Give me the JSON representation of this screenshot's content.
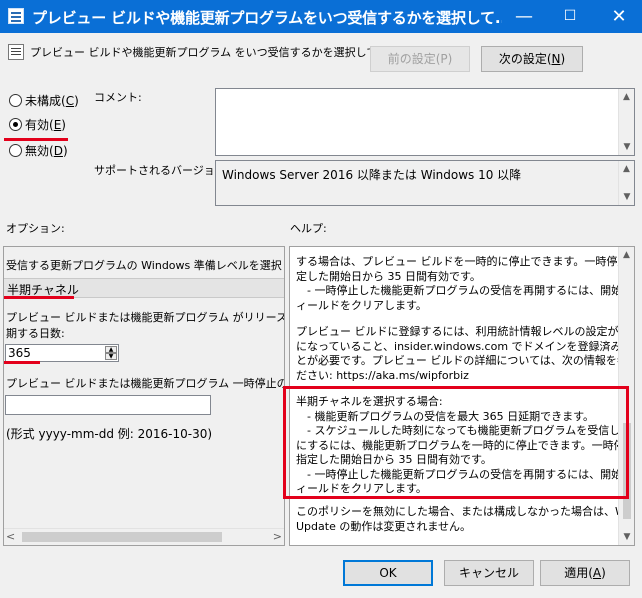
{
  "window": {
    "title": "プレビュー ビルドや機能更新プログラムをいつ受信するかを選択して...",
    "minimize_glyph": "—",
    "maximize_glyph": "☐",
    "close_glyph": "✕"
  },
  "header": {
    "text": "プレビュー ビルドや機能更新プログラム をいつ受信するかを選択してください",
    "prev_button": "前の設定(P)",
    "next_button_prefix": "次の設定(",
    "next_button_key": "N",
    "next_button_suffix": ")"
  },
  "radios": [
    {
      "prefix": "未構成(",
      "key": "C",
      "suffix": ")",
      "selected": false
    },
    {
      "prefix": "有効(",
      "key": "E",
      "suffix": ")",
      "selected": true
    },
    {
      "prefix": "無効(",
      "key": "D",
      "suffix": ")",
      "selected": false
    }
  ],
  "comment_label": "コメント:",
  "supported_label": "サポートされるバージョン:",
  "supported_value": "Windows Server 2016 以降または Windows 10 以降",
  "options_label": "オプション:",
  "help_label": "ヘルプ:",
  "options": {
    "receive_level": "受信する更新プログラムの Windows 準備レベルを選択して",
    "channel": "半期チャネル",
    "defer_line1": "プレビュー ビルドまたは機能更新プログラム がリリースされた後、",
    "defer_line2": "期する日数:",
    "defer_days": "365",
    "pause_label": "プレビュー ビルドまたは機能更新プログラム 一時停止の開始日",
    "pause_value": "",
    "format_hint": "(形式 yyyy-mm-dd 例: 2016-10-30)"
  },
  "help": {
    "p1": [
      "する場合は、プレビュー ビルドを一時的に停止できます。一時停止は、指",
      "定した開始日から 35 日間有効です。",
      "　- 一時停止した機能更新プログラムの受信を再開するには、開始日フ",
      "ィールドをクリアします。"
    ],
    "p2": [
      "プレビュー ビルドに登録するには、利用統計情報レベルの設定が 2 以上",
      "になっていること、insider.windows.com でドメインを登録済みであるこ",
      "とが必要です。プレビュー ビルドの詳細については、次の情報を参照してく",
      "ださい: https://aka.ms/wipforbiz"
    ],
    "p3": [
      "半期チャネルを選択する場合:",
      "　- 機能更新プログラムの受信を最大 365 日延期できます。",
      "　- スケジュールした時刻になっても機能更新プログラムを受信しないよう",
      "にするには、機能更新プログラムを一時的に停止できます。一時停止は、",
      "指定した開始日から 35 日間有効です。",
      "　- 一時停止した機能更新プログラムの受信を再開するには、開始日フ",
      "ィールドをクリアします。"
    ],
    "p4": [
      "このポリシーを無効にした場合、または構成しなかった場合は、Windows",
      "Update の動作は変更されません。"
    ]
  },
  "footer": {
    "ok": "OK",
    "cancel": "キャンセル",
    "apply_prefix": "適用(",
    "apply_key": "A",
    "apply_suffix": ")"
  },
  "colors": {
    "titlebar": "#0a6fd6",
    "annotation_red": "#e3001b",
    "focus_blue": "#0078d7"
  }
}
